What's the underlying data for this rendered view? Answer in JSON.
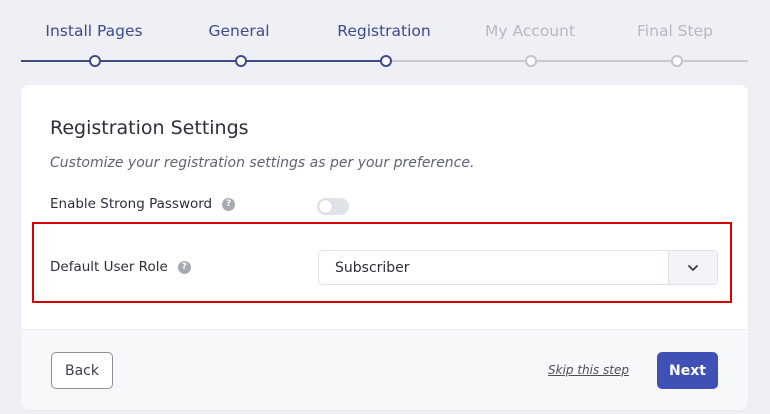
{
  "stepper": {
    "steps": [
      {
        "label": "Install Pages",
        "state": "done"
      },
      {
        "label": "General",
        "state": "done"
      },
      {
        "label": "Registration",
        "state": "current"
      },
      {
        "label": "My Account",
        "state": "todo"
      },
      {
        "label": "Final Step",
        "state": "todo"
      }
    ]
  },
  "card": {
    "title": "Registration Settings",
    "subtitle": "Customize your registration settings as per your preference.",
    "strong_password": {
      "label": "Enable Strong Password",
      "enabled": false
    },
    "user_role": {
      "label": "Default User Role",
      "value": "Subscriber"
    }
  },
  "footer": {
    "back_label": "Back",
    "skip_label": "Skip this step",
    "next_label": "Next"
  },
  "colors": {
    "accent": "#3f51b5",
    "step_done": "#3f4a8a",
    "step_todo": "#b6b9c2",
    "highlight": "#d90000"
  },
  "icons": {
    "help": "question-mark-circle",
    "dropdown": "chevron-down"
  }
}
